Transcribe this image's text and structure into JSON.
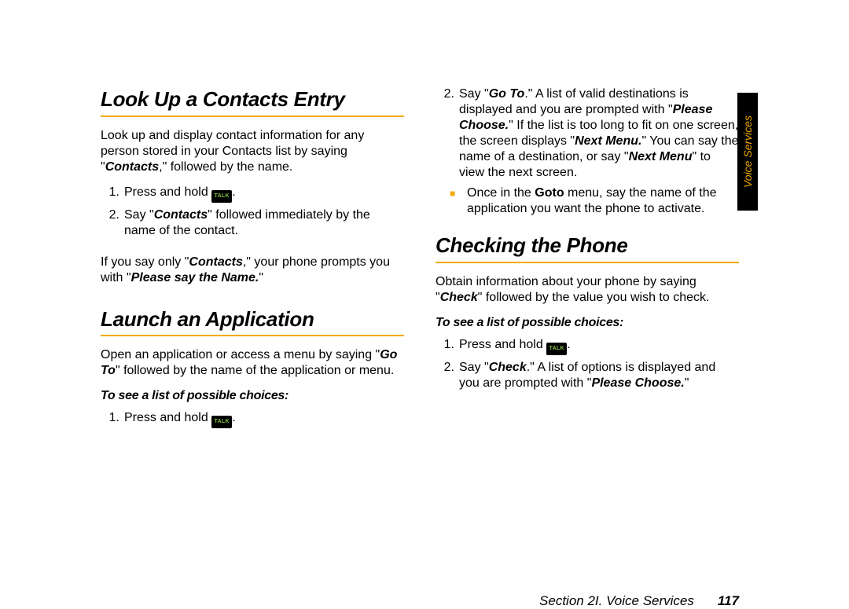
{
  "tab": "Voice Services",
  "footer": {
    "section": "Section 2I. Voice Services",
    "page": "117"
  },
  "talkLabel": "TALK",
  "left": {
    "h1": "Look Up a Contacts Entry",
    "p1a": "Look up and display contact information for any person stored in your Contacts list by saying \"",
    "p1b": "Contacts",
    "p1c": ",\" followed by the name.",
    "s1n": "1.",
    "s1a": "Press and hold ",
    "s1b": ".",
    "s2n": "2.",
    "s2a": "Say \"",
    "s2b": "Contacts",
    "s2c": "\" followed immediately by the name of the contact.",
    "p2a": "If you say only \"",
    "p2b": "Contacts",
    "p2c": ",\" your phone prompts you with \"",
    "p2d": "Please say the Name.",
    "p2e": "\"",
    "h2": "Launch an Application",
    "p3a": "Open an application or access a menu by saying \"",
    "p3b": "Go To",
    "p3c": "\" followed by the name of the application or menu.",
    "sub1": "To see a list of possible choices:",
    "s3n": "1.",
    "s3a": "Press and hold ",
    "s3b": "."
  },
  "right": {
    "s1n": "2.",
    "s1a": "Say \"",
    "s1b": "Go To",
    "s1c": ".\" A list of valid destinations is displayed and you are prompted with \"",
    "s1d": "Please Choose.",
    "s1e": "\" If the list is too long to fit on one screen, the screen displays \"",
    "s1f": "Next Menu.",
    "s1g": "\" You can say the name of a destination, or say \"",
    "s1h": "Next Menu",
    "s1i": "\" to view the next screen.",
    "b1a": "Once in the ",
    "b1b": "Goto",
    "b1c": " menu, say the name of the application you want the phone to activate.",
    "h1": "Checking the Phone",
    "p1a": "Obtain information about your phone by saying \"",
    "p1b": "Check",
    "p1c": "\" followed by the value you wish to check.",
    "sub1": "To see a list of possible choices:",
    "s2n": "1.",
    "s2a": "Press and hold ",
    "s2b": ".",
    "s3n": "2.",
    "s3a": "Say \"",
    "s3b": "Check",
    "s3c": ".\" A list of options is displayed and you are prompted with \"",
    "s3d": "Please Choose.",
    "s3e": "\""
  }
}
